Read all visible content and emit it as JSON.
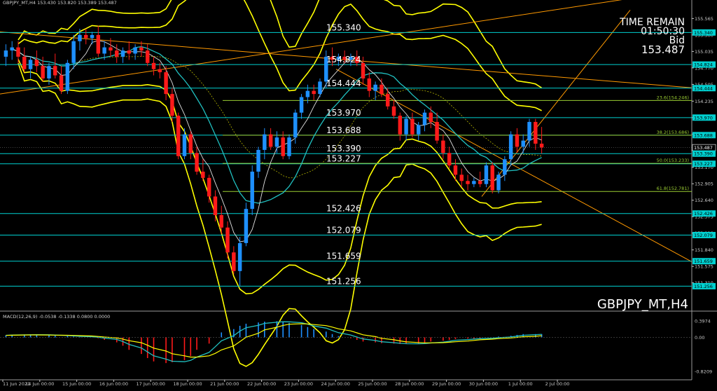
{
  "header": {
    "symbol_line": "GBPJPY_MT,H4  153.430 153.820 153.389 153.487",
    "watermark": "GBPJPY_MT,H4"
  },
  "info_box": {
    "time_remain_label": "TIME REMAIN",
    "time_remain_value": "01:50:30",
    "bid_label": "Bid",
    "bid_value": "153.487"
  },
  "macd": {
    "label": "MACD(12,26,9) -0.0538 -0.1338 0.0800 0.0000",
    "ticks": [
      "0.3974",
      "0.00",
      "-0.8209"
    ]
  },
  "colors": {
    "background": "#000000",
    "bull": "#1e90ff",
    "bear": "#ff1a1a",
    "bollinger": "#ffff00",
    "level_line": "#00d0d0",
    "fib_line": "#9acd32",
    "trend_line": "#ff9900",
    "ma_line": "#20c0c0",
    "ma_white": "#e0e0e0",
    "axis_text": "#c8c8c8"
  },
  "chart_data": {
    "type": "candlestick",
    "title": "GBPJPY_MT,H4",
    "ylim": [
      150.9,
      155.75
    ],
    "x_tick_labels": [
      "11 Jun 2021",
      "14 Jun 00:00",
      "15 Jun 00:00",
      "16 Jun 00:00",
      "17 Jun 00:00",
      "18 Jun 00:00",
      "21 Jun 00:00",
      "22 Jun 00:00",
      "23 Jun 00:00",
      "24 Jun 00:00",
      "25 Jun 00:00",
      "28 Jun 00:00",
      "29 Jun 00:00",
      "30 Jun 00:00",
      "1 Jul 00:00",
      "2 Jul 00:00"
    ],
    "y_tick_labels": [
      "155.565",
      "155.300",
      "155.035",
      "154.770",
      "154.505",
      "154.235",
      "153.970",
      "153.705",
      "153.440",
      "153.170",
      "152.905",
      "152.640",
      "152.375",
      "152.110",
      "151.840",
      "151.575",
      "151.310"
    ],
    "y_tick_values": [
      155.565,
      155.3,
      155.035,
      154.77,
      154.505,
      154.235,
      153.97,
      153.705,
      153.44,
      153.17,
      152.905,
      152.64,
      152.375,
      152.11,
      151.84,
      151.575,
      151.31
    ],
    "axis_marker_labels": [
      "155.340",
      "154.824",
      "154.444",
      "153.970",
      "153.688",
      "153.487",
      "153.390",
      "153.227",
      "152.426",
      "152.079",
      "151.659",
      "151.256"
    ],
    "price_levels": [
      155.34,
      154.824,
      154.444,
      153.97,
      153.688,
      153.39,
      153.227,
      152.426,
      152.079,
      151.659,
      151.256
    ],
    "price_level_labels": [
      "155.340",
      "154.824",
      "154.444",
      "153.970",
      "153.688",
      "153.390",
      "153.227",
      "152.426",
      "152.079",
      "151.659",
      "151.256"
    ],
    "fib_levels": [
      {
        "label": "23.6(154.246)",
        "value": 154.246
      },
      {
        "label": "38.2(153.686)",
        "value": 153.686
      },
      {
        "label": "50.0(153.233)",
        "value": 153.233
      },
      {
        "label": "61.8(152.781)",
        "value": 152.781
      }
    ],
    "current_price": 153.487,
    "candles": [
      {
        "o": 154.95,
        "h": 155.15,
        "l": 154.8,
        "c": 155.05
      },
      {
        "o": 155.05,
        "h": 155.2,
        "l": 154.9,
        "c": 155.1
      },
      {
        "o": 155.1,
        "h": 155.2,
        "l": 154.85,
        "c": 154.95
      },
      {
        "o": 154.95,
        "h": 155.1,
        "l": 154.7,
        "c": 154.75
      },
      {
        "o": 154.75,
        "h": 154.95,
        "l": 154.6,
        "c": 154.9
      },
      {
        "o": 154.9,
        "h": 155.05,
        "l": 154.7,
        "c": 154.8
      },
      {
        "o": 154.8,
        "h": 154.95,
        "l": 154.55,
        "c": 154.6
      },
      {
        "o": 154.6,
        "h": 154.85,
        "l": 154.5,
        "c": 154.8
      },
      {
        "o": 154.8,
        "h": 155.0,
        "l": 154.6,
        "c": 154.65
      },
      {
        "o": 154.65,
        "h": 154.8,
        "l": 154.35,
        "c": 154.4
      },
      {
        "o": 154.4,
        "h": 154.9,
        "l": 154.35,
        "c": 154.85
      },
      {
        "o": 154.85,
        "h": 155.3,
        "l": 154.75,
        "c": 155.2
      },
      {
        "o": 155.2,
        "h": 155.4,
        "l": 155.05,
        "c": 155.3
      },
      {
        "o": 155.3,
        "h": 155.4,
        "l": 155.15,
        "c": 155.25
      },
      {
        "o": 155.25,
        "h": 155.35,
        "l": 155.15,
        "c": 155.3
      },
      {
        "o": 155.3,
        "h": 155.45,
        "l": 154.95,
        "c": 155.0
      },
      {
        "o": 155.0,
        "h": 155.2,
        "l": 154.9,
        "c": 155.1
      },
      {
        "o": 155.1,
        "h": 155.25,
        "l": 154.95,
        "c": 155.05
      },
      {
        "o": 155.05,
        "h": 155.15,
        "l": 154.85,
        "c": 154.95
      },
      {
        "o": 154.95,
        "h": 155.1,
        "l": 154.85,
        "c": 155.05
      },
      {
        "o": 155.05,
        "h": 155.2,
        "l": 154.9,
        "c": 155.0
      },
      {
        "o": 155.0,
        "h": 155.15,
        "l": 154.9,
        "c": 155.1
      },
      {
        "o": 155.1,
        "h": 155.2,
        "l": 154.95,
        "c": 155.05
      },
      {
        "o": 155.05,
        "h": 155.15,
        "l": 154.8,
        "c": 154.85
      },
      {
        "o": 154.85,
        "h": 154.95,
        "l": 154.65,
        "c": 154.75
      },
      {
        "o": 154.75,
        "h": 154.85,
        "l": 154.6,
        "c": 154.7
      },
      {
        "o": 154.7,
        "h": 154.8,
        "l": 154.25,
        "c": 154.35
      },
      {
        "o": 154.35,
        "h": 154.45,
        "l": 153.9,
        "c": 154.0
      },
      {
        "o": 154.0,
        "h": 154.05,
        "l": 153.3,
        "c": 153.35
      },
      {
        "o": 153.35,
        "h": 153.8,
        "l": 153.3,
        "c": 153.7
      },
      {
        "o": 153.7,
        "h": 153.75,
        "l": 153.3,
        "c": 153.4
      },
      {
        "o": 153.4,
        "h": 153.5,
        "l": 153.05,
        "c": 153.1
      },
      {
        "o": 153.1,
        "h": 153.3,
        "l": 152.95,
        "c": 153.0
      },
      {
        "o": 153.0,
        "h": 153.05,
        "l": 152.6,
        "c": 152.7
      },
      {
        "o": 152.7,
        "h": 152.8,
        "l": 152.3,
        "c": 152.4
      },
      {
        "o": 152.4,
        "h": 152.55,
        "l": 152.1,
        "c": 152.2
      },
      {
        "o": 152.2,
        "h": 152.3,
        "l": 151.7,
        "c": 151.8
      },
      {
        "o": 151.8,
        "h": 151.9,
        "l": 151.45,
        "c": 151.5
      },
      {
        "o": 151.5,
        "h": 152.05,
        "l": 151.26,
        "c": 151.95
      },
      {
        "o": 151.95,
        "h": 152.6,
        "l": 151.9,
        "c": 152.5
      },
      {
        "o": 152.5,
        "h": 153.2,
        "l": 152.4,
        "c": 153.1
      },
      {
        "o": 153.1,
        "h": 153.5,
        "l": 153.0,
        "c": 153.45
      },
      {
        "o": 153.45,
        "h": 153.8,
        "l": 153.3,
        "c": 153.7
      },
      {
        "o": 153.7,
        "h": 153.8,
        "l": 153.45,
        "c": 153.5
      },
      {
        "o": 153.5,
        "h": 153.75,
        "l": 153.4,
        "c": 153.65
      },
      {
        "o": 153.65,
        "h": 153.75,
        "l": 153.3,
        "c": 153.35
      },
      {
        "o": 153.35,
        "h": 153.7,
        "l": 153.3,
        "c": 153.65
      },
      {
        "o": 153.65,
        "h": 154.1,
        "l": 153.55,
        "c": 154.05
      },
      {
        "o": 154.05,
        "h": 154.35,
        "l": 153.95,
        "c": 154.3
      },
      {
        "o": 154.3,
        "h": 154.5,
        "l": 154.2,
        "c": 154.4
      },
      {
        "o": 154.4,
        "h": 154.5,
        "l": 154.25,
        "c": 154.35
      },
      {
        "o": 154.35,
        "h": 154.6,
        "l": 154.3,
        "c": 154.55
      },
      {
        "o": 154.55,
        "h": 155.05,
        "l": 154.45,
        "c": 154.95
      },
      {
        "o": 154.95,
        "h": 155.1,
        "l": 154.8,
        "c": 154.9
      },
      {
        "o": 154.9,
        "h": 155.0,
        "l": 154.8,
        "c": 154.95
      },
      {
        "o": 154.95,
        "h": 155.05,
        "l": 154.85,
        "c": 154.9
      },
      {
        "o": 154.9,
        "h": 155.0,
        "l": 154.8,
        "c": 154.95
      },
      {
        "o": 154.95,
        "h": 155.05,
        "l": 154.8,
        "c": 154.85
      },
      {
        "o": 154.85,
        "h": 154.95,
        "l": 154.5,
        "c": 154.6
      },
      {
        "o": 154.6,
        "h": 154.7,
        "l": 154.3,
        "c": 154.4
      },
      {
        "o": 154.4,
        "h": 154.55,
        "l": 154.25,
        "c": 154.5
      },
      {
        "o": 154.5,
        "h": 154.6,
        "l": 154.3,
        "c": 154.35
      },
      {
        "o": 154.35,
        "h": 154.45,
        "l": 154.1,
        "c": 154.15
      },
      {
        "o": 154.15,
        "h": 154.25,
        "l": 153.95,
        "c": 154.0
      },
      {
        "o": 154.0,
        "h": 154.05,
        "l": 153.6,
        "c": 153.7
      },
      {
        "o": 153.7,
        "h": 154.0,
        "l": 153.6,
        "c": 153.95
      },
      {
        "o": 153.95,
        "h": 154.05,
        "l": 153.65,
        "c": 153.7
      },
      {
        "o": 153.7,
        "h": 153.9,
        "l": 153.6,
        "c": 153.85
      },
      {
        "o": 153.85,
        "h": 154.1,
        "l": 153.75,
        "c": 154.05
      },
      {
        "o": 154.05,
        "h": 154.15,
        "l": 153.8,
        "c": 153.9
      },
      {
        "o": 153.9,
        "h": 154.05,
        "l": 153.55,
        "c": 153.6
      },
      {
        "o": 153.6,
        "h": 153.7,
        "l": 153.3,
        "c": 153.4
      },
      {
        "o": 153.4,
        "h": 153.5,
        "l": 153.15,
        "c": 153.2
      },
      {
        "o": 153.2,
        "h": 153.3,
        "l": 152.95,
        "c": 153.05
      },
      {
        "o": 153.05,
        "h": 153.15,
        "l": 152.85,
        "c": 152.95
      },
      {
        "o": 152.95,
        "h": 153.05,
        "l": 152.8,
        "c": 152.9
      },
      {
        "o": 152.9,
        "h": 153.0,
        "l": 152.85,
        "c": 152.95
      },
      {
        "o": 152.95,
        "h": 153.1,
        "l": 152.85,
        "c": 152.9
      },
      {
        "o": 152.9,
        "h": 153.25,
        "l": 152.85,
        "c": 153.2
      },
      {
        "o": 153.2,
        "h": 153.25,
        "l": 152.75,
        "c": 152.8
      },
      {
        "o": 152.8,
        "h": 153.1,
        "l": 152.75,
        "c": 153.05
      },
      {
        "o": 153.05,
        "h": 153.35,
        "l": 152.95,
        "c": 153.3
      },
      {
        "o": 153.3,
        "h": 153.75,
        "l": 153.2,
        "c": 153.7
      },
      {
        "o": 153.7,
        "h": 153.8,
        "l": 153.4,
        "c": 153.5
      },
      {
        "o": 153.5,
        "h": 153.7,
        "l": 153.4,
        "c": 153.6
      },
      {
        "o": 153.6,
        "h": 153.95,
        "l": 153.5,
        "c": 153.9
      },
      {
        "o": 153.9,
        "h": 153.95,
        "l": 153.45,
        "c": 153.55
      },
      {
        "o": 153.55,
        "h": 153.82,
        "l": 153.39,
        "c": 153.49
      }
    ],
    "macd_histogram": [
      0.05,
      0.06,
      0.07,
      0.07,
      0.06,
      0.05,
      0.04,
      0.03,
      0.02,
      0.01,
      0.0,
      -0.02,
      -0.06,
      -0.12,
      -0.2,
      -0.3,
      -0.4,
      -0.5,
      -0.58,
      -0.62,
      -0.6,
      -0.55,
      -0.45,
      -0.3,
      -0.15,
      0.0,
      0.12,
      0.2,
      0.28,
      0.33,
      0.36,
      0.38,
      0.39,
      0.38,
      0.35,
      0.3,
      0.25,
      0.2,
      0.14,
      0.08,
      0.03,
      -0.02,
      -0.06,
      -0.1,
      -0.12,
      -0.14,
      -0.15,
      -0.16,
      -0.16,
      -0.15,
      -0.13,
      -0.1,
      -0.08,
      -0.06,
      -0.04,
      -0.03,
      -0.03,
      -0.02,
      0.0,
      0.02,
      0.04,
      0.06,
      0.08,
      0.08,
      0.08
    ],
    "macd_ylim": [
      -0.8209,
      0.3974
    ]
  }
}
